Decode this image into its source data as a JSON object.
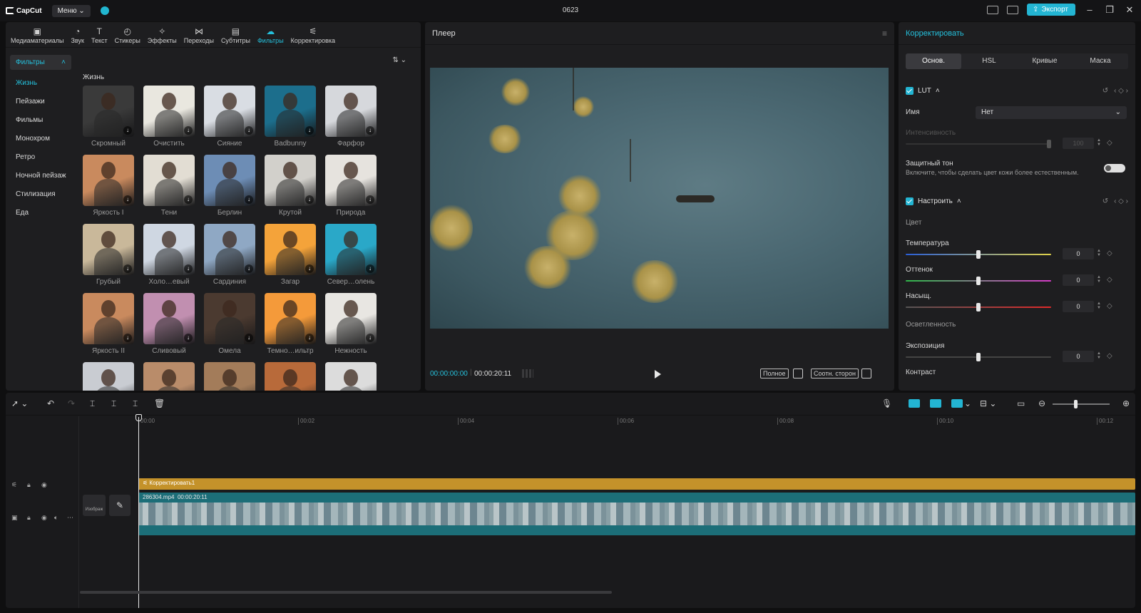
{
  "titlebar": {
    "logo": "CapCut",
    "menu": "Меню",
    "project": "0623",
    "export": "Экспорт"
  },
  "media_tools": [
    {
      "label": "Медиаматериалы",
      "icon": "media-icon"
    },
    {
      "label": "Звук",
      "icon": "audio-icon"
    },
    {
      "label": "Текст",
      "icon": "text-icon"
    },
    {
      "label": "Стикеры",
      "icon": "sticker-icon"
    },
    {
      "label": "Эффекты",
      "icon": "effects-icon"
    },
    {
      "label": "Переходы",
      "icon": "transitions-icon"
    },
    {
      "label": "Субтитры",
      "icon": "captions-icon"
    },
    {
      "label": "Фильтры",
      "icon": "filters-icon",
      "active": true
    },
    {
      "label": "Корректировка",
      "icon": "adjust-icon"
    }
  ],
  "sidebar": {
    "head": "Фильтры",
    "items": [
      "Жизнь",
      "Пейзажи",
      "Фильмы",
      "Монохром",
      "Ретро",
      "Ночной пейзаж",
      "Стилизация",
      "Еда"
    ]
  },
  "grid": {
    "title": "Жизнь",
    "items": [
      {
        "label": "Скромный",
        "color": "#3a3a3a"
      },
      {
        "label": "Очистить",
        "color": "#e9e7df"
      },
      {
        "label": "Сияние",
        "color": "#d9dde3"
      },
      {
        "label": "Badbunny",
        "color": "#1c6e8c"
      },
      {
        "label": "Фарфор",
        "color": "#d6d8dc"
      },
      {
        "label": "Яркость I",
        "color": "#c98a5e"
      },
      {
        "label": "Тени",
        "color": "#e2ddd3"
      },
      {
        "label": "Берлин",
        "color": "#6d8db5"
      },
      {
        "label": "Крутой",
        "color": "#d2d0cb"
      },
      {
        "label": "Природа",
        "color": "#e6e3de"
      },
      {
        "label": "Грубый",
        "color": "#c9b89a"
      },
      {
        "label": "Холо…евый",
        "color": "#cfd7e2"
      },
      {
        "label": "Сардиния",
        "color": "#8fa8c4"
      },
      {
        "label": "Загар",
        "color": "#f4a33a"
      },
      {
        "label": "Север…олень",
        "color": "#2aa8c8"
      },
      {
        "label": "Яркость II",
        "color": "#c98a5e"
      },
      {
        "label": "Сливовый",
        "color": "#c18fb0"
      },
      {
        "label": "Омела",
        "color": "#4b3a30"
      },
      {
        "label": "Темно…ильтр",
        "color": "#f49a3a"
      },
      {
        "label": "Нежность",
        "color": "#e8e6e2"
      },
      {
        "label": "",
        "color": "#c9ccd2"
      },
      {
        "label": "",
        "color": "#b98c6a"
      },
      {
        "label": "",
        "color": "#a37c5a"
      },
      {
        "label": "",
        "color": "#b86a3a"
      },
      {
        "label": "",
        "color": "#dcdcdc"
      }
    ]
  },
  "player": {
    "title": "Плеер",
    "current": "00:00:00:00",
    "duration": "00:00:20:11",
    "btn_full": "Полное",
    "btn_ratio": "Соотн. сторон"
  },
  "adjust": {
    "title": "Корректировать",
    "tabs": [
      "Основ.",
      "HSL",
      "Кривые",
      "Маска"
    ],
    "lut": "LUT",
    "name_label": "Имя",
    "name_value": "Нет",
    "intensity_label": "Интенсивность",
    "intensity_value": "100",
    "protect_label": "Защитный тон",
    "protect_desc": "Включите, чтобы сделать цвет кожи более естественным.",
    "tune": "Настроить",
    "color_group": "Цвет",
    "temperature": "Температура",
    "temperature_value": "0",
    "tint": "Оттенок",
    "tint_value": "0",
    "saturation": "Насыщ.",
    "saturation_value": "0",
    "light_group": "Осветленность",
    "exposure": "Экспозиция",
    "exposure_value": "0",
    "contrast": "Контраст"
  },
  "timeline": {
    "ticks": [
      "00:00",
      "00:02",
      "00:04",
      "00:06",
      "00:08",
      "00:10",
      "00:12"
    ],
    "adj_clip": "Корректировать1",
    "video_name": "286304.mp4",
    "video_dur": "00:00:20:11",
    "cover": "Изображ"
  },
  "colors": {
    "accent": "#23b5d3",
    "adj_clip": "#c4922a",
    "video_clip": "#1c6e78"
  }
}
